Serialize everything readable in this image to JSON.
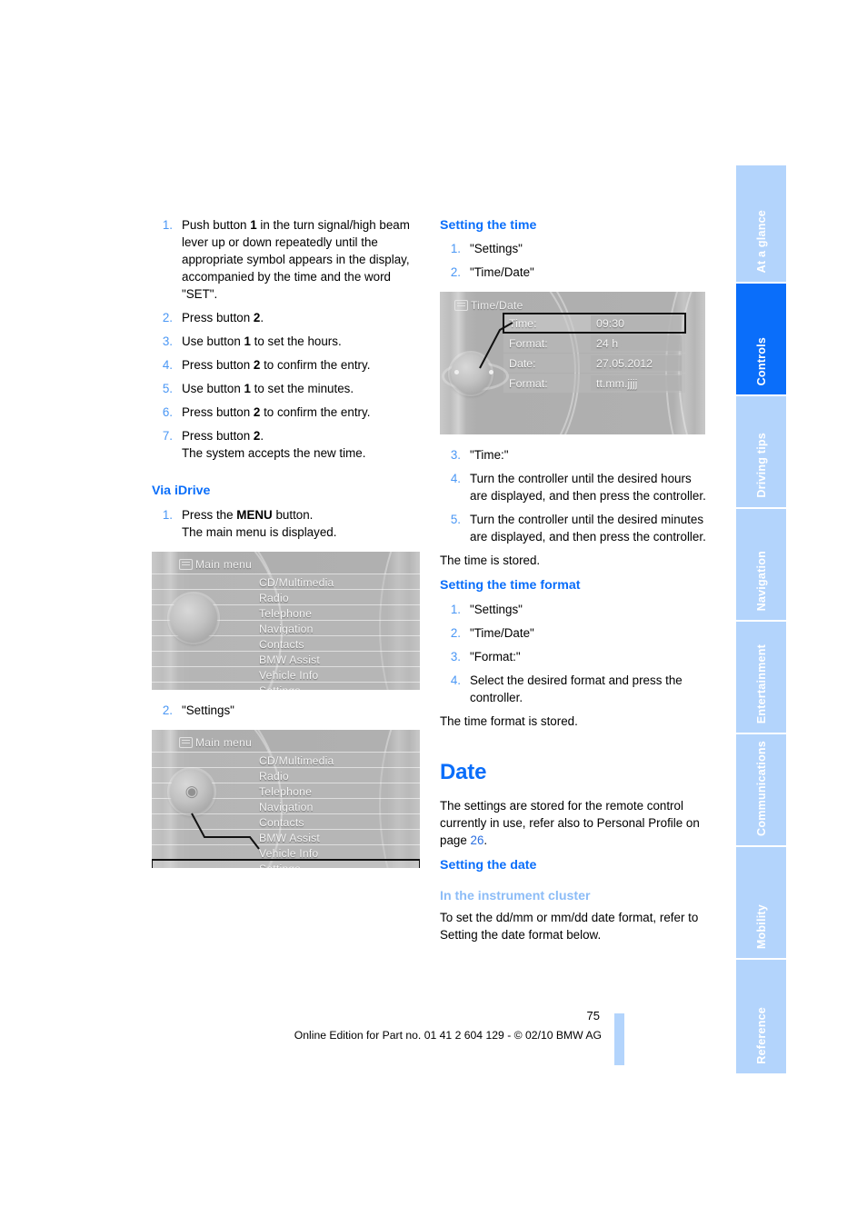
{
  "document": {
    "page_number": "75",
    "edition_line": "Online Edition for Part no. 01 41 2 604 129 - © 02/10 BMW AG"
  },
  "tabs": [
    {
      "label": "At a glance",
      "active": false
    },
    {
      "label": "Controls",
      "active": true
    },
    {
      "label": "Driving tips",
      "active": false
    },
    {
      "label": "Navigation",
      "active": false
    },
    {
      "label": "Entertainment",
      "active": false
    },
    {
      "label": "Communications",
      "active": false
    },
    {
      "label": "Mobility",
      "active": false
    },
    {
      "label": "Reference",
      "active": false
    }
  ],
  "left_column": {
    "instrument_steps": [
      {
        "num": "1",
        "html": "Push button <b>1</b> in the turn signal/high beam lever up or down repeatedly until the appropriate symbol appears in the display, accompanied by the time and the word \"SET\"."
      },
      {
        "num": "2",
        "html": "Press button <b>2</b>."
      },
      {
        "num": "3",
        "html": "Use button <b>1</b> to set the hours."
      },
      {
        "num": "4",
        "html": "Press button <b>2</b> to confirm the entry."
      },
      {
        "num": "5",
        "html": "Use button <b>1</b> to set the minutes."
      },
      {
        "num": "6",
        "html": "Press button <b>2</b> to confirm the entry."
      },
      {
        "num": "7",
        "html": "Press button <b>2</b>.<br>The system accepts the new time."
      }
    ],
    "via_idrive_heading": "Via iDrive",
    "idrive_step_1": {
      "num": "1",
      "html": "Press the <b>MENU</b> button.<br>The main menu is displayed."
    },
    "idrive_step_2": {
      "num": "2",
      "html": "\"Settings\""
    }
  },
  "main_menu_screen": {
    "title": "Main menu",
    "items": [
      "CD/Multimedia",
      "Radio",
      "Telephone",
      "Navigation",
      "Contacts",
      "BMW Assist",
      "Vehicle Info",
      "Settings"
    ],
    "selected_item": "Settings"
  },
  "right_column": {
    "setting_the_time_heading": "Setting the time",
    "setting_the_time_steps": [
      {
        "num": "1",
        "html": "\"Settings\""
      },
      {
        "num": "2",
        "html": "\"Time/Date\""
      }
    ],
    "setting_the_time_steps_after": [
      {
        "num": "3",
        "html": "\"Time:\""
      },
      {
        "num": "4",
        "html": "Turn the controller until the desired hours are displayed, and then press the controller."
      },
      {
        "num": "5",
        "html": "Turn the controller until the desired minutes are displayed, and then press the controller."
      }
    ],
    "time_stored_note": "The time is stored.",
    "setting_the_time_format_heading": "Setting the time format",
    "setting_the_time_format_steps": [
      {
        "num": "1",
        "html": "\"Settings\""
      },
      {
        "num": "2",
        "html": "\"Time/Date\""
      },
      {
        "num": "3",
        "html": "\"Format:\""
      },
      {
        "num": "4",
        "html": "Select the desired format and press the controller."
      }
    ],
    "time_format_stored_note": "The time format is stored.",
    "date_heading": "Date",
    "date_intro_html": "The settings are stored for the remote control currently in use, refer also to Personal Profile on page <span class=\"pagelink\">26</span>.",
    "setting_the_date_heading": "Setting the date",
    "in_the_instrument_cluster_heading": "In the instrument cluster",
    "in_the_instrument_cluster_text": "To set the dd/mm or mm/dd date format, refer to Setting the date format below."
  },
  "time_date_screen": {
    "title": "Time/Date",
    "rows": [
      {
        "label": "Time:",
        "value": "09:30",
        "selected": true
      },
      {
        "label": "Format:",
        "value": "24 h",
        "selected": false
      },
      {
        "label": "Date:",
        "value": "27.05.2012",
        "selected": false
      },
      {
        "label": "Format:",
        "value": "tt.mm.jjjj",
        "selected": false
      }
    ]
  },
  "colors": {
    "accent_blue": "#0a6efa",
    "light_blue": "#b3d4fc",
    "mid_blue": "#5aa2f7",
    "pale_blue": "#8cbcf7"
  }
}
